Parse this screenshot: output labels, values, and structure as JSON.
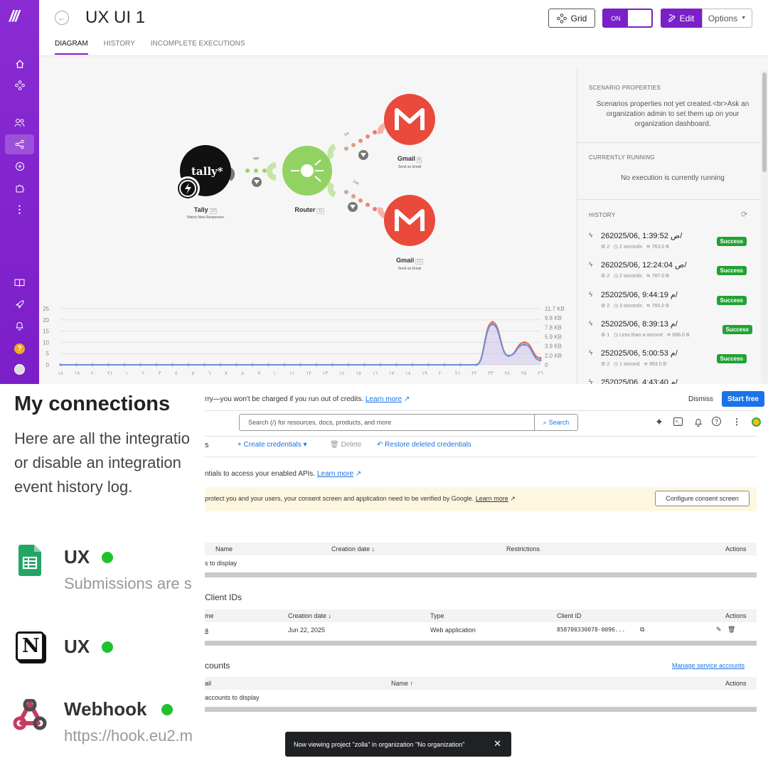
{
  "make": {
    "scenario_title": "UX UI 1",
    "tabs": [
      "DIAGRAM",
      "HISTORY",
      "INCOMPLETE EXECUTIONS"
    ],
    "grid_label": "Grid",
    "toggle_label": "ON",
    "edit_label": "Edit",
    "options_label": "Options",
    "modules": {
      "tally": {
        "logo": "tally*",
        "name": "Tally",
        "num": "10",
        "sub": "Watch New Responses"
      },
      "router": {
        "name": "Router",
        "num": "11"
      },
      "gmail1": {
        "name": "Gmail",
        "num": "6",
        "sub": "Send an Email"
      },
      "gmail2": {
        "name": "Gmail",
        "num": "12",
        "sub": "Send an Email"
      }
    },
    "link_labels": {
      "tally_router": "age",
      "route1": "1st",
      "route2": "2nd"
    },
    "panel": {
      "props_title": "SCENARIO PROPERTIES",
      "props_text": "Scenarios properties not yet created.<br>Ask an organization admin to set them up on your organization dashboard.",
      "running_title": "CURRENTLY RUNNING",
      "running_text": "No execution is currently running",
      "history_title": "HISTORY",
      "history": [
        {
          "date": "26ص 1:39:52 ,2025/06/",
          "ops": "2",
          "duration": "2 seconds",
          "size": "763.0 B",
          "status": "Success"
        },
        {
          "date": "26ص 12:24:04 ,2025/06/",
          "ops": "2",
          "duration": "2 seconds",
          "size": "787.0 B",
          "status": "Success"
        },
        {
          "date": "25م 9:44:19 ,2025/06/",
          "ops": "2",
          "duration": "3 seconds",
          "size": "765.0 B",
          "status": "Success"
        },
        {
          "date": "25م 8:39:13 ,2025/06/",
          "ops": "1",
          "duration": "Less than a second",
          "size": "686.0 B",
          "status": "Success"
        },
        {
          "date": "25م 5:00:53 ,2025/06/",
          "ops": "2",
          "duration": "1 second",
          "size": "963.0 B",
          "status": "Success"
        },
        {
          "date": "25م 4:43:40 ,2025/06/",
          "ops": "",
          "duration": "",
          "size": "",
          "status": ""
        }
      ]
    }
  },
  "chart_data": {
    "type": "area",
    "y_left_ticks": [
      "25",
      "20",
      "15",
      "10",
      "5",
      "0"
    ],
    "y_right_ticks": [
      "11.7 KB",
      "9.8 KB",
      "7.8 KB",
      "5.9 KB",
      "3.9 KB",
      "2.0 KB",
      "0"
    ],
    "x_tick_labels": [
      "١٨",
      "١٩",
      "٢٠",
      "٢١",
      "١",
      "٢",
      "٣",
      "٤",
      "٥",
      "٦",
      "٧",
      "٨",
      "٩",
      "١٠",
      "١١",
      "١٢",
      "١٣",
      "١٤",
      "١٥",
      "١٦",
      "١٧",
      "١٨",
      "١٩",
      "٢٠",
      "٢١",
      "٢٢",
      "٢٣",
      "٢٤",
      "٢٥",
      "٢٦"
    ],
    "ylim": [
      0,
      25
    ],
    "series": [
      {
        "values": [
          0,
          0,
          0,
          0,
          0,
          0,
          0,
          0,
          0,
          0,
          0,
          0,
          0,
          0,
          0,
          0,
          0,
          0,
          0,
          0,
          0,
          0,
          0,
          0,
          0,
          0,
          0,
          19,
          4,
          10,
          3
        ],
        "color": "#e86a5c"
      },
      {
        "values": [
          0,
          0,
          0,
          0,
          0,
          0,
          0,
          0,
          0,
          0,
          0,
          0,
          0,
          0,
          0,
          0,
          0,
          0,
          0,
          0,
          0,
          0,
          0,
          0,
          0,
          0,
          0,
          18,
          4,
          9,
          2
        ],
        "color": "#6a8fd6"
      }
    ]
  },
  "connections": {
    "title": "My connections",
    "desc_lines": [
      "Here are all the integratio",
      "or disable an integration",
      "event history log."
    ],
    "items": [
      {
        "name": "UX",
        "sub": "Submissions are s",
        "icon": "google-sheets-icon"
      },
      {
        "name": "UX",
        "sub": "",
        "icon": "notion-icon"
      },
      {
        "name": "Webhook",
        "sub": "https://hook.eu2.m",
        "icon": "webhook-icon"
      }
    ]
  },
  "gcloud": {
    "banner_text": "rry—you won't be charged if you run out of credits.",
    "learn_more": "Learn more",
    "dismiss": "Dismiss",
    "start_free": "Start free",
    "search_placeholder": "Search (/) for resources, docs, products, and more",
    "search_btn": "Search",
    "partial_s": "s",
    "create_credentials": "Create credentials",
    "delete": "Delete",
    "restore": "Restore deleted credentials",
    "intro_text": "ntials to access your enabled APIs.",
    "intro_link": "Learn more",
    "consent_text": "protect you and your users, your consent screen and application need to be verified by Google.",
    "consent_link": "Learn more",
    "configure_btn": "Configure consent screen",
    "api_keys": {
      "cols": [
        "Name",
        "Creation date",
        "Restrictions",
        "Actions"
      ],
      "empty": "s to display"
    },
    "oauth": {
      "title": "Client IDs",
      "cols": [
        "me",
        "Creation date",
        "Type",
        "Client ID",
        "Actions"
      ],
      "row": {
        "name": "a",
        "date": "Jun 22, 2025",
        "type": "Web application",
        "client_id": "858700330078-0096..."
      }
    },
    "service": {
      "title": "counts",
      "manage": "Manage service accounts",
      "cols": [
        "ail",
        "Name",
        "Actions"
      ],
      "empty": "accounts to display"
    },
    "toast": "Now viewing project \"zolla\" in organization \"No organization\""
  }
}
